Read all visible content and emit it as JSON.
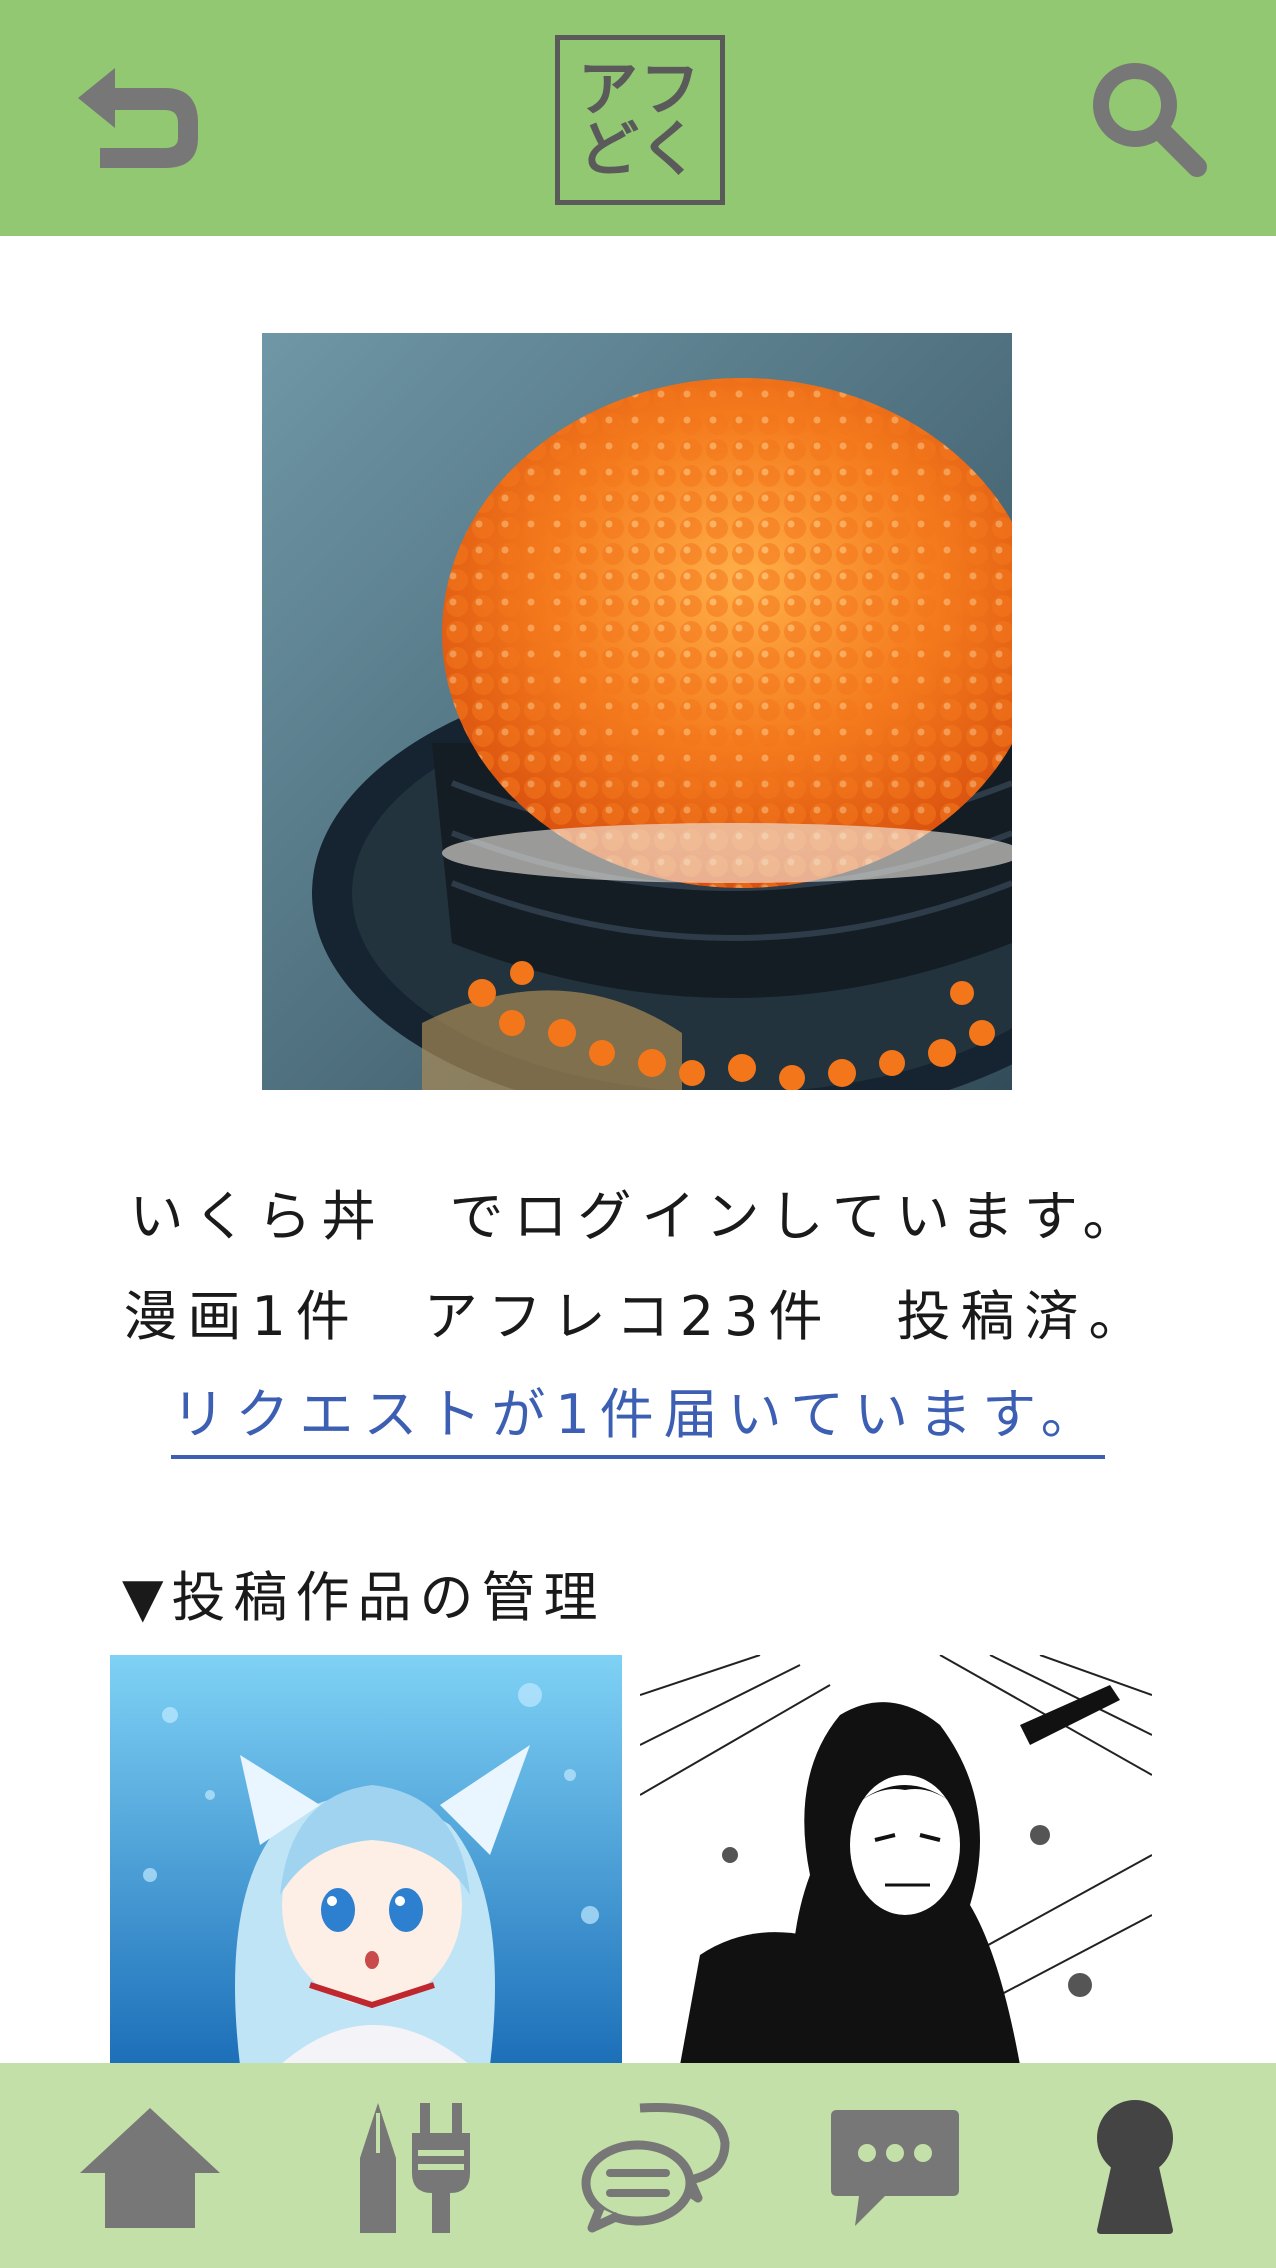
{
  "header": {
    "logo_line1": "アフ",
    "logo_line2": "どく",
    "back_icon": "back-arrow-icon",
    "search_icon": "search-icon"
  },
  "profile": {
    "login_line_name": "いくら丼",
    "login_line_suffix": "でログインしています。",
    "stats_line": "漫画1件　アフレコ23件　投稿済。",
    "request_link": "リクエストが1件届いています。"
  },
  "section": {
    "title": "▼投稿作品の管理"
  },
  "nav": {
    "items": [
      {
        "icon": "home-icon"
      },
      {
        "icon": "pen-plug-icon"
      },
      {
        "icon": "speech-bubbles-icon"
      },
      {
        "icon": "chat-icon"
      },
      {
        "icon": "keyhole-icon"
      }
    ]
  },
  "colors": {
    "header_bg": "#92c872",
    "nav_bg": "#c3e0a8",
    "icon_gray": "#777777",
    "link_blue": "#3d5fb3"
  }
}
